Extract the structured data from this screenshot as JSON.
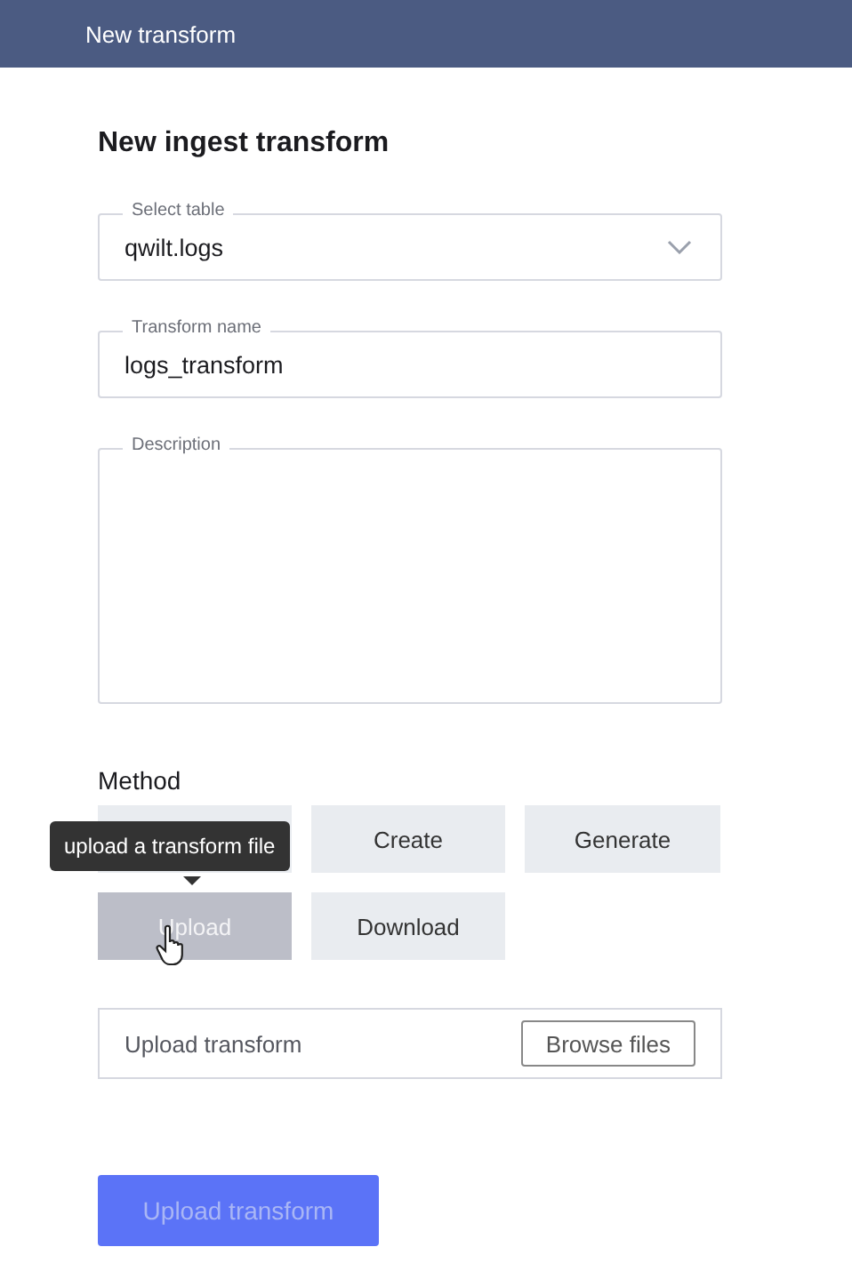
{
  "header": {
    "title": "New transform"
  },
  "form": {
    "title": "New ingest transform",
    "table_select": {
      "label": "Select table",
      "value": "qwilt.logs"
    },
    "name_field": {
      "label": "Transform name",
      "value": "logs_transform"
    },
    "description_field": {
      "label": "Description"
    },
    "method": {
      "label": "Method",
      "options": [
        {
          "selected": false
        },
        {
          "label": "Create",
          "selected": false
        },
        {
          "label": "Generate",
          "selected": false
        },
        {
          "label": "Upload",
          "selected": true
        },
        {
          "label": "Download",
          "selected": false
        }
      ],
      "tooltip": "upload a transform file"
    },
    "upload": {
      "placeholder": "Upload transform",
      "browse_button": "Browse files"
    },
    "submit": {
      "label": "Upload transform",
      "disabled": true
    }
  }
}
